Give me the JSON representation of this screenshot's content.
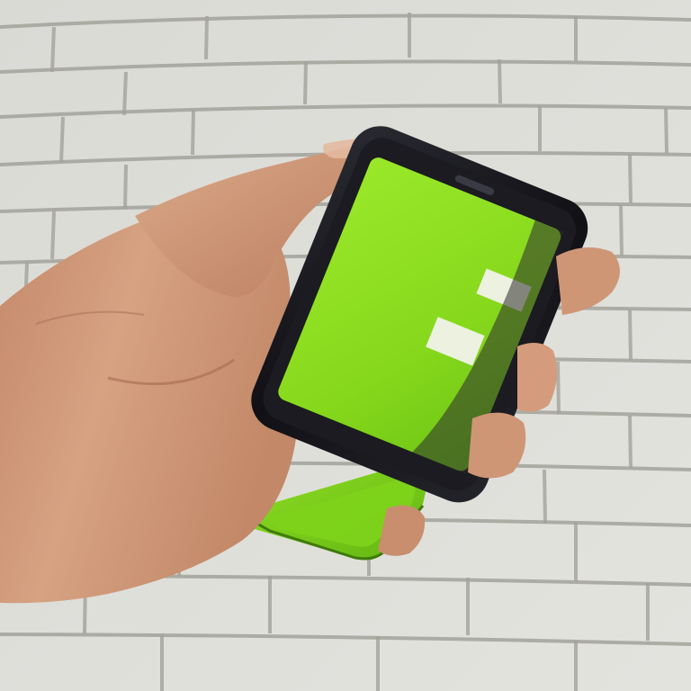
{
  "scene": {
    "subject": "hand-holding-phones",
    "colors": {
      "wall_base": "#d9d9d4",
      "brick_light": "#e4e4df",
      "brick_shade": "#c9c9c3",
      "mortar": "#9d9d96",
      "skin_light": "#d49f7e",
      "skin_mid": "#c08565",
      "skin_dark": "#9a6448",
      "phone_body": "#141419",
      "phone_bezel": "#27272f",
      "screen_green": "#8ee01f",
      "screen_green_dark": "#5fb412",
      "back_phone_green": "#7fd019",
      "highlight": "#f4f4ee"
    }
  }
}
